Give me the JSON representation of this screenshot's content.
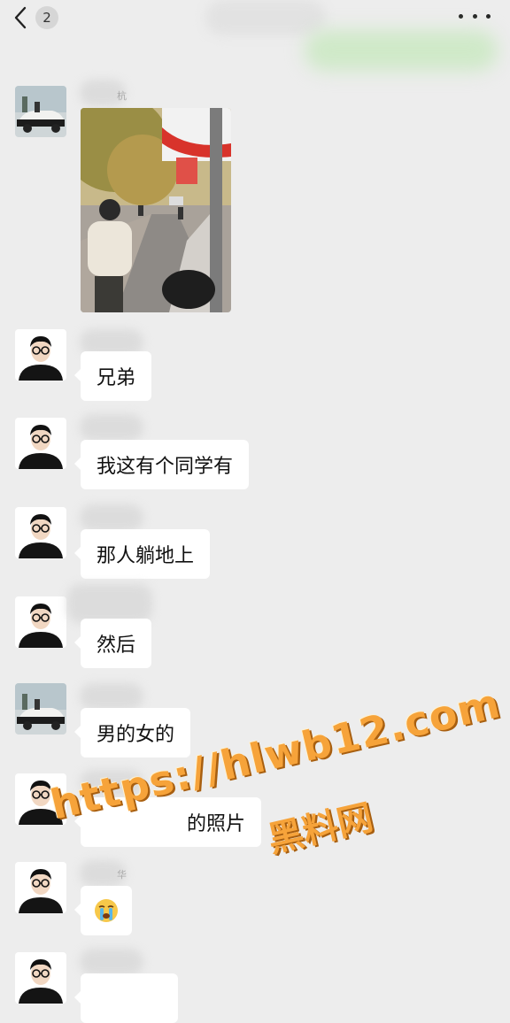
{
  "header": {
    "unread_count": "2",
    "back_icon": "chevron-left-icon",
    "more_icon": "more-dots-icon"
  },
  "colors": {
    "background": "#ededed",
    "bubble": "#ffffff",
    "watermark": "#f6a33a"
  },
  "messages": [
    {
      "type": "image",
      "avatar": "car-avatar",
      "sender_fragment": "杭",
      "image_desc": "street-photo"
    },
    {
      "type": "text",
      "avatar": "cartoon-avatar",
      "text": "兄弟"
    },
    {
      "type": "text",
      "avatar": "cartoon-avatar",
      "text": "我这有个同学有"
    },
    {
      "type": "text",
      "avatar": "cartoon-avatar",
      "text": "那人躺地上"
    },
    {
      "type": "text",
      "avatar": "cartoon-avatar",
      "text": "然后"
    },
    {
      "type": "text",
      "avatar": "car-avatar",
      "text": "男的女的"
    },
    {
      "type": "text",
      "avatar": "cartoon-avatar",
      "text": "的照片"
    },
    {
      "type": "emoji",
      "avatar": "cartoon-avatar",
      "emoji": "crying-face-icon",
      "sender_fragment": "华"
    },
    {
      "type": "text",
      "avatar": "cartoon-avatar",
      "text": ""
    }
  ],
  "watermark": {
    "url": "https://hlwb12.com",
    "site_name": "黑料网"
  }
}
